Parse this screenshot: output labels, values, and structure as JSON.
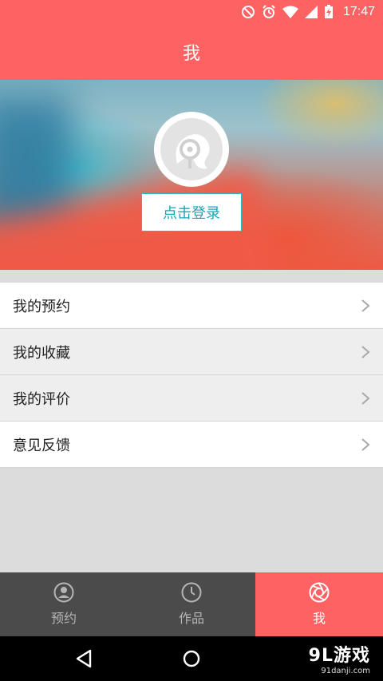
{
  "status_bar": {
    "time": "17:47"
  },
  "header": {
    "title": "我"
  },
  "profile": {
    "login_label": "点击登录"
  },
  "menu": {
    "items": [
      {
        "label": "我的预约"
      },
      {
        "label": "我的收藏"
      },
      {
        "label": "我的评价"
      },
      {
        "label": "意见反馈"
      }
    ]
  },
  "tabs": [
    {
      "label": "预约",
      "icon": "person-icon"
    },
    {
      "label": "作品",
      "icon": "clock-icon"
    },
    {
      "label": "我",
      "icon": "aperture-icon",
      "active": true
    }
  ],
  "watermark": {
    "brand": "9L游戏",
    "url": "91danji.com"
  },
  "colors": {
    "accent": "#ff6262",
    "login_text": "#14a7b8",
    "tab_bg": "#4b4b4b"
  }
}
